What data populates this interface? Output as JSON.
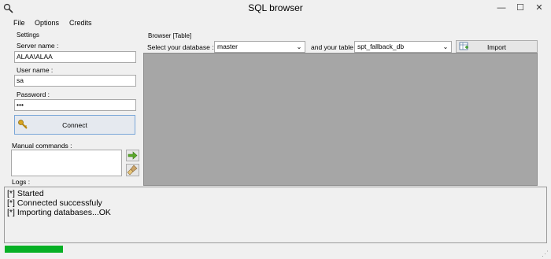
{
  "window": {
    "title": "SQL browser",
    "minimize": "—",
    "maximize": "☐",
    "close": "✕"
  },
  "menu": {
    "items": [
      "File",
      "Options",
      "Credits"
    ]
  },
  "settings": {
    "group_label": "Settings",
    "server_label": "Server name :",
    "server_value": "ALAA\\ALAA",
    "user_label": "User name :",
    "user_value": "sa",
    "password_label": "Password :",
    "password_value": "•••",
    "connect_label": "Connect"
  },
  "manual": {
    "label": "Manual commands :",
    "value": ""
  },
  "browser": {
    "group_label": "Browser [Table]",
    "database_label": "Select your database :",
    "database_value": "master",
    "table_label": "and your table :",
    "table_value": "spt_fallback_db",
    "import_label": "Import"
  },
  "logs": {
    "label": "Logs :",
    "lines": [
      "[*] Started",
      "[*] Connected successfuly",
      "[*] Importing databases...OK"
    ]
  },
  "progress": {
    "fraction": 0.107
  },
  "colors": {
    "progress": "#06b025",
    "grid_bg": "#a6a6a6"
  },
  "icons": [
    "app-icon",
    "key-icon",
    "run-arrow-icon",
    "clear-brush-icon",
    "import-icon",
    "chevron-down-icon"
  ]
}
